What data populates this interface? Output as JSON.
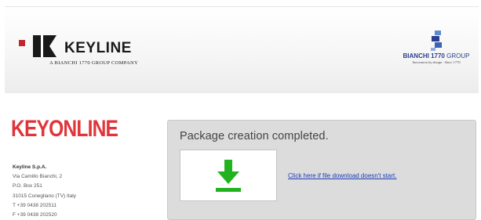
{
  "header": {
    "keyline_logo": {
      "wordmark": "KEYLINE",
      "tagline": "A BIANCHI 1770 GROUP COMPANY",
      "accent_color": "#c0272d"
    },
    "bianchi_logo": {
      "wordmark_bold": "BIANCHI 1770",
      "wordmark_thin": " GROUP",
      "subtitle": "Innovation by design · Since 1770",
      "color": "#2a3f8f"
    }
  },
  "sidebar": {
    "brand_title": "KEYONLINE",
    "brand_color": "#e0353b",
    "address": {
      "company": "Keyline S.p.A.",
      "lines": [
        "Via Camillo Bianchi, 2",
        "P.O. Box 251",
        "31015 Conegliano (TV) Italy",
        "T +39 0438 202511",
        "F +39 0438 202520"
      ]
    }
  },
  "panel": {
    "message": "Package creation completed.",
    "download_icon": "download-arrow-icon",
    "download_icon_color": "#22b21f",
    "fallback_link": "Click here if file download doesn't start."
  }
}
